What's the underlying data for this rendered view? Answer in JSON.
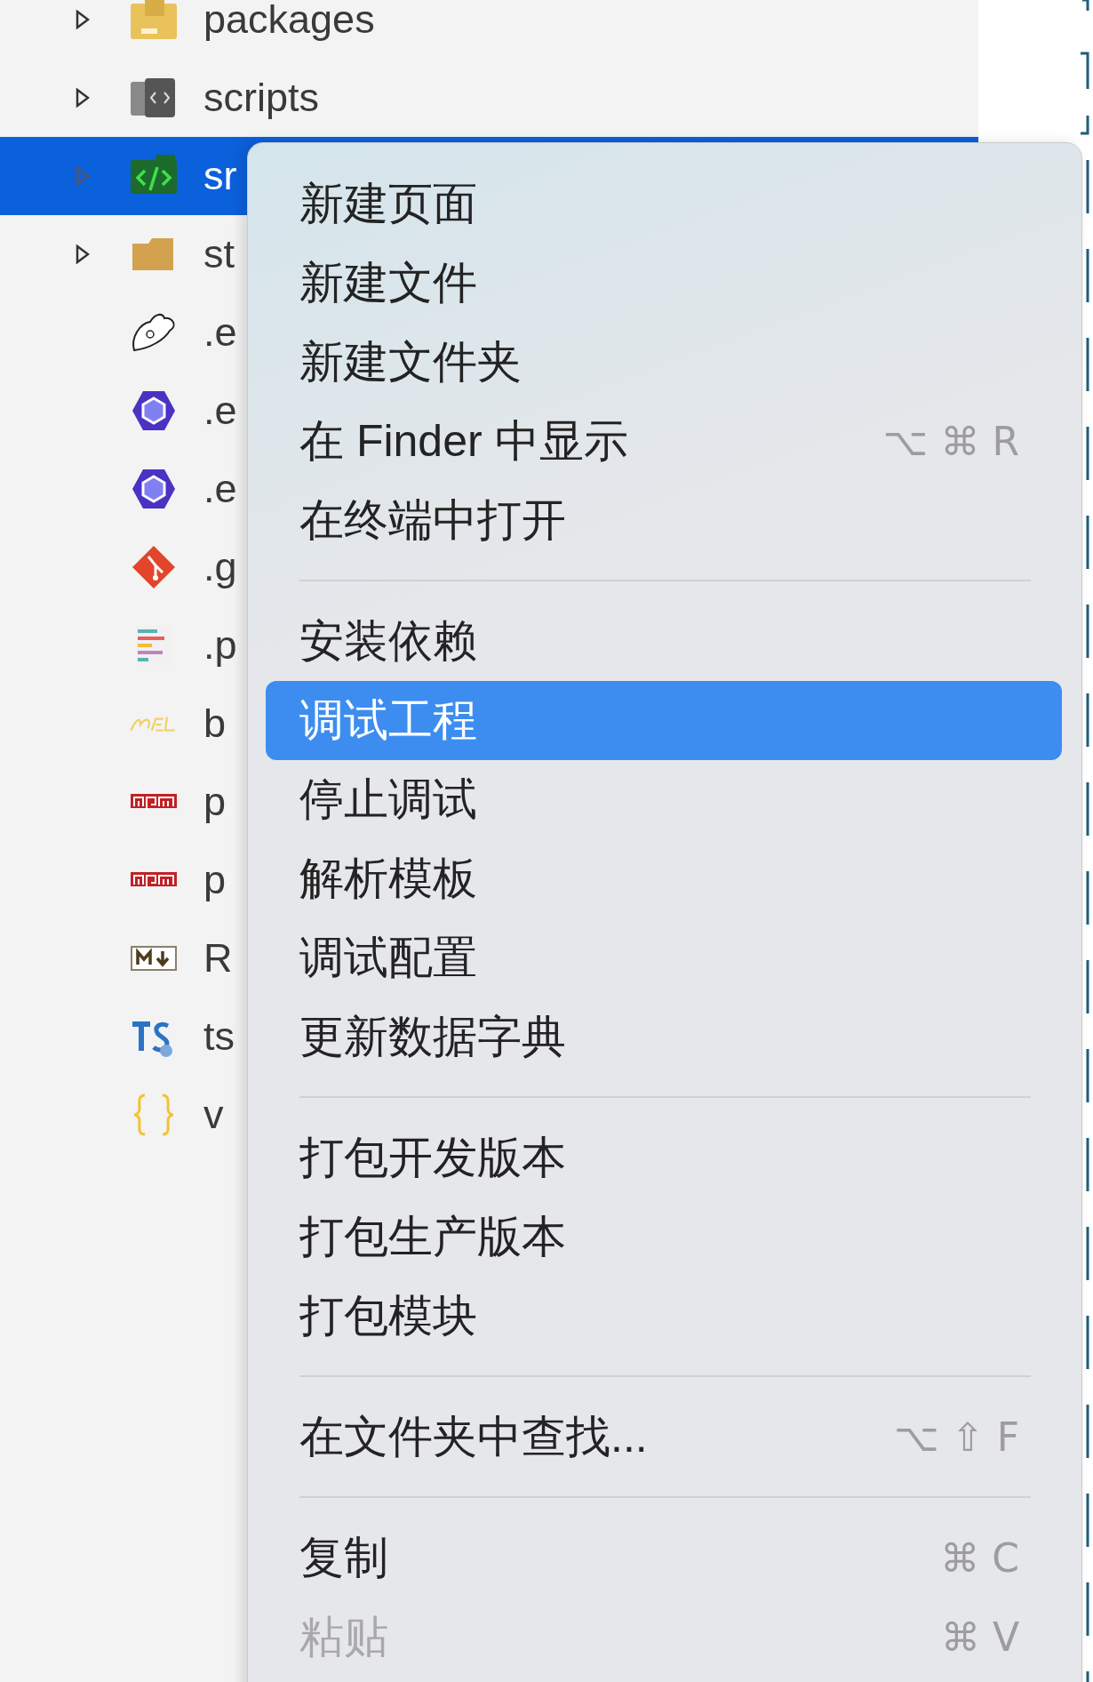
{
  "tree": {
    "items": [
      {
        "name": "packages",
        "kind": "package-folder",
        "expandable": true,
        "selected": false
      },
      {
        "name": "scripts",
        "kind": "script-folder",
        "expandable": true,
        "selected": false
      },
      {
        "name": "sr",
        "kind": "code-folder",
        "expandable": true,
        "selected": true
      },
      {
        "name": "st",
        "kind": "folder",
        "expandable": true,
        "selected": false
      },
      {
        "name": ".e",
        "kind": "mouse",
        "expandable": false,
        "selected": false
      },
      {
        "name": ".e",
        "kind": "hexagon",
        "expandable": false,
        "selected": false
      },
      {
        "name": ".e",
        "kind": "hexagon",
        "expandable": false,
        "selected": false
      },
      {
        "name": ".g",
        "kind": "git",
        "expandable": false,
        "selected": false
      },
      {
        "name": ".p",
        "kind": "prettier",
        "expandable": false,
        "selected": false
      },
      {
        "name": "b",
        "kind": "babel",
        "expandable": false,
        "selected": false
      },
      {
        "name": "p",
        "kind": "npm",
        "expandable": false,
        "selected": false
      },
      {
        "name": "p",
        "kind": "npm",
        "expandable": false,
        "selected": false
      },
      {
        "name": "R",
        "kind": "markdown",
        "expandable": false,
        "selected": false
      },
      {
        "name": "ts",
        "kind": "typescript",
        "expandable": false,
        "selected": false
      },
      {
        "name": "v",
        "kind": "json",
        "expandable": false,
        "selected": false
      }
    ]
  },
  "context_menu": {
    "groups": [
      [
        {
          "label": "新建页面",
          "selected": false,
          "disabled": false
        },
        {
          "label": "新建文件",
          "selected": false,
          "disabled": false
        },
        {
          "label": "新建文件夹",
          "selected": false,
          "disabled": false
        },
        {
          "label": "在 Finder 中显示",
          "shortcut": "⌥ ⌘ R",
          "selected": false,
          "disabled": false
        },
        {
          "label": "在终端中打开",
          "selected": false,
          "disabled": false
        }
      ],
      [
        {
          "label": "安装依赖",
          "selected": false,
          "disabled": false
        },
        {
          "label": "调试工程",
          "selected": true,
          "disabled": false
        },
        {
          "label": "停止调试",
          "selected": false,
          "disabled": false
        },
        {
          "label": "解析模板",
          "selected": false,
          "disabled": false
        },
        {
          "label": "调试配置",
          "selected": false,
          "disabled": false
        },
        {
          "label": "更新数据字典",
          "selected": false,
          "disabled": false
        }
      ],
      [
        {
          "label": "打包开发版本",
          "selected": false,
          "disabled": false
        },
        {
          "label": "打包生产版本",
          "selected": false,
          "disabled": false
        },
        {
          "label": "打包模块",
          "selected": false,
          "disabled": false
        }
      ],
      [
        {
          "label": "在文件夹中查找...",
          "shortcut": "⌥ ⇧ F",
          "selected": false,
          "disabled": false
        }
      ],
      [
        {
          "label": "复制",
          "shortcut": "⌘ C",
          "selected": false,
          "disabled": false
        },
        {
          "label": "粘贴",
          "shortcut": "⌘ V",
          "selected": false,
          "disabled": true
        }
      ]
    ]
  }
}
